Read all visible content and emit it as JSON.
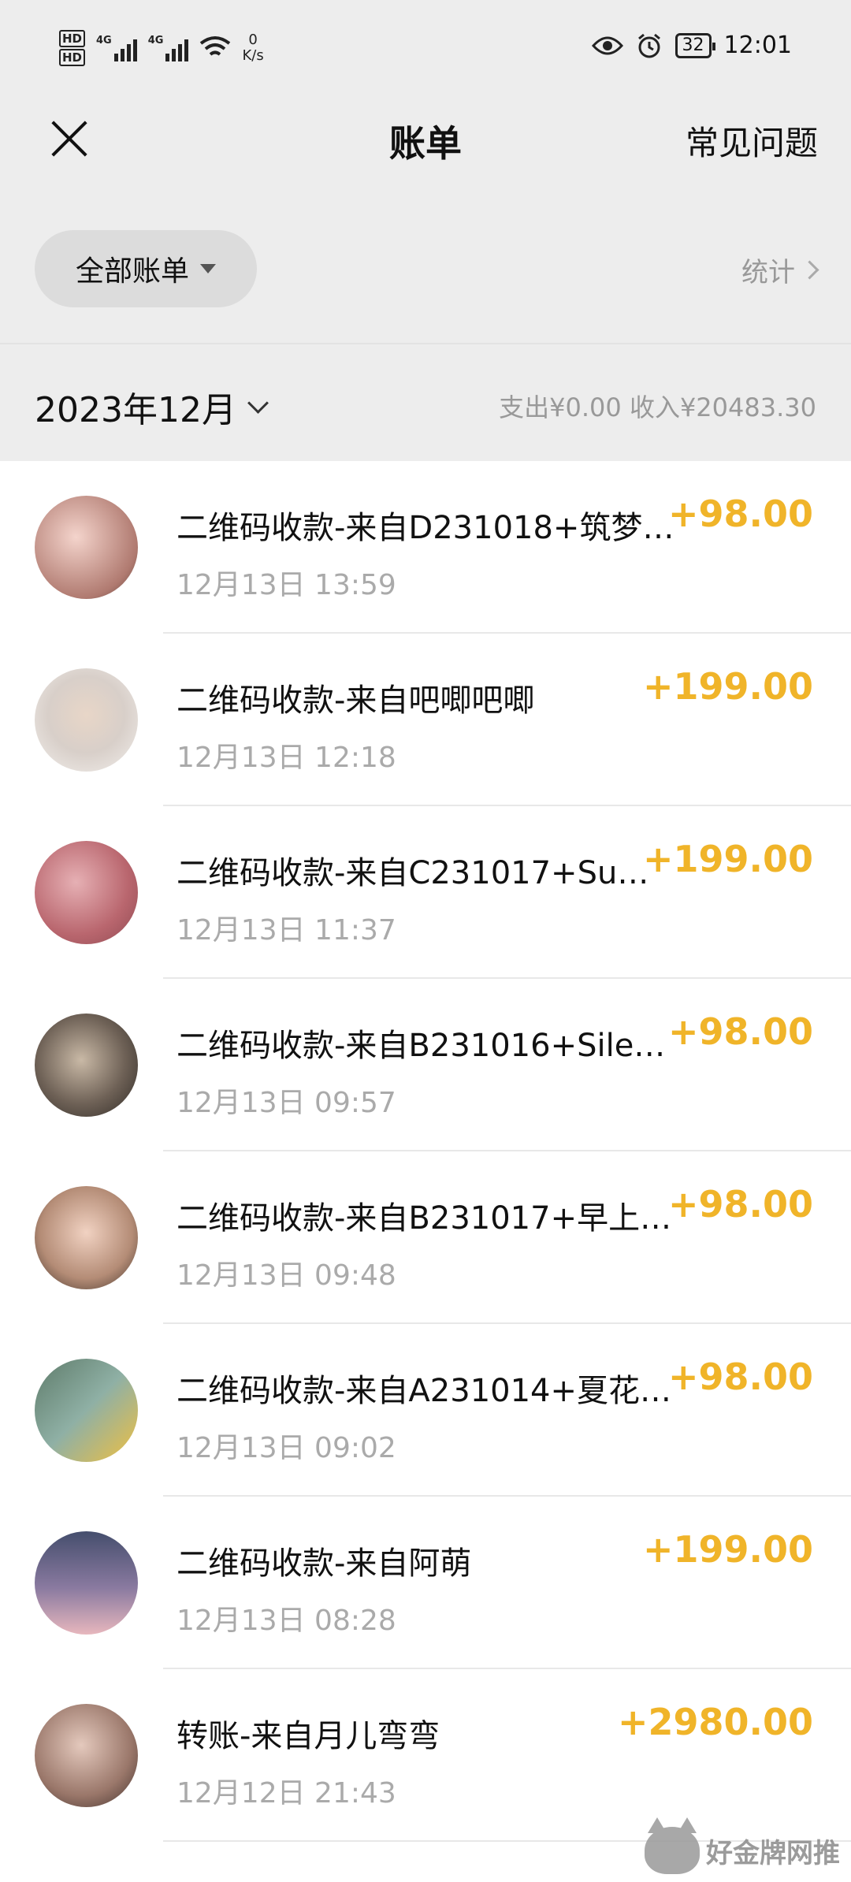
{
  "status_bar": {
    "hd1": "HD",
    "hd2": "HD",
    "sig1_label": "4G",
    "sig2_label": "4G",
    "net_speed_value": "0",
    "net_speed_unit": "K/s",
    "battery": "32",
    "time": "12:01"
  },
  "nav": {
    "title": "账单",
    "faq": "常见问题"
  },
  "filter": {
    "label": "全部账单",
    "stats": "统计"
  },
  "month": {
    "label": "2023年12月",
    "summary": "支出¥0.00 收入¥20483.30"
  },
  "transactions": [
    {
      "desc": "二维码收款-来自D231018+筑梦…",
      "time": "12月13日 13:59",
      "amount": "+98.00"
    },
    {
      "desc": "二维码收款-来自吧唧吧唧",
      "time": "12月13日 12:18",
      "amount": "+199.00"
    },
    {
      "desc": "二维码收款-来自C231017+Su…",
      "time": "12月13日 11:37",
      "amount": "+199.00"
    },
    {
      "desc": "二维码收款-来自B231016+Sile…",
      "time": "12月13日 09:57",
      "amount": "+98.00"
    },
    {
      "desc": "二维码收款-来自B231017+早上…",
      "time": "12月13日 09:48",
      "amount": "+98.00"
    },
    {
      "desc": "二维码收款-来自A231014+夏花…",
      "time": "12月13日 09:02",
      "amount": "+98.00"
    },
    {
      "desc": "二维码收款-来自阿萌",
      "time": "12月13日 08:28",
      "amount": "+199.00"
    },
    {
      "desc": "转账-来自月儿弯弯",
      "time": "12月12日 21:43",
      "amount": "+2980.00"
    }
  ],
  "watermark": "好金牌网推",
  "colors": {
    "amount": "#f0b429",
    "header_bg": "#ededed"
  }
}
